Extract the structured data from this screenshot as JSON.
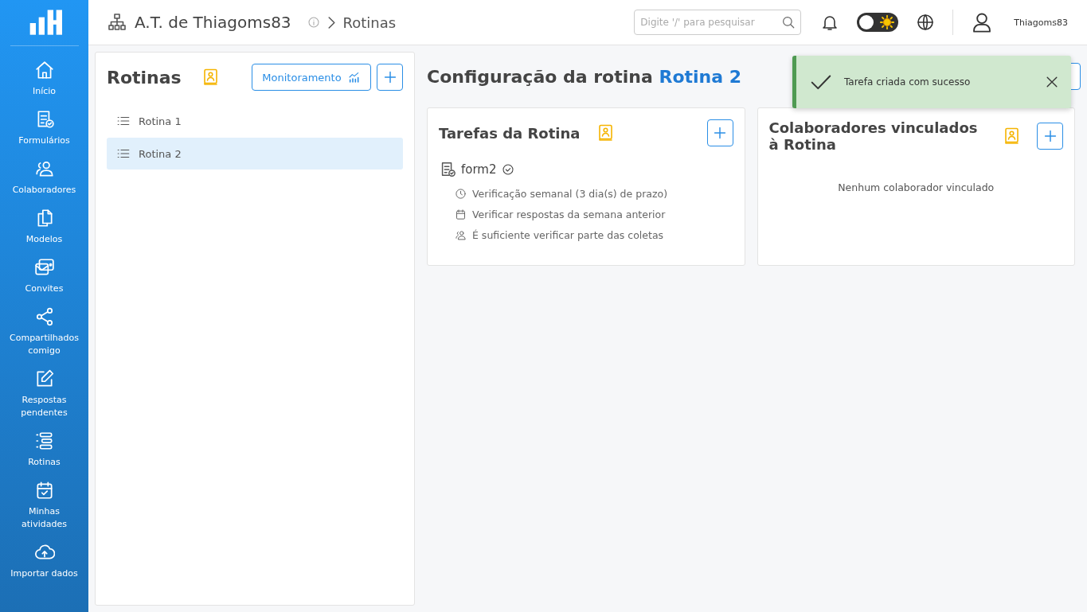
{
  "sidebar": {
    "items": [
      {
        "kind": "home",
        "label": "Início",
        "selected": false
      },
      {
        "kind": "form",
        "label": "Formulários",
        "selected": false
      },
      {
        "kind": "people",
        "label": "Colaboradores",
        "selected": false
      },
      {
        "kind": "copy",
        "label": "Modelos",
        "selected": false
      },
      {
        "kind": "mail",
        "label": "Convites",
        "selected": false
      },
      {
        "kind": "share",
        "label": "Compartilhados comigo",
        "selected": false
      },
      {
        "kind": "edit",
        "label": "Respostas pendentes",
        "selected": false
      },
      {
        "kind": "list",
        "label": "Rotinas",
        "selected": false
      },
      {
        "kind": "calendar",
        "label": "Minhas atividades",
        "selected": false
      },
      {
        "kind": "cloud",
        "label": "Importar dados",
        "selected": false
      }
    ]
  },
  "header": {
    "breadcrumb": [
      "A.T. de Thiagoms83",
      "Rotinas"
    ],
    "search": {
      "placeholder": "Digite '/' para pesquisar"
    },
    "dark_mode": false,
    "user": "Thiagoms83"
  },
  "routines_panel": {
    "title": "Rotinas",
    "monitor_button": "Monitoramento",
    "items": [
      {
        "label": "Rotina 1",
        "selected": false
      },
      {
        "label": "Rotina 2",
        "selected": true
      }
    ]
  },
  "config": {
    "title": "Configuração da rotina",
    "routine_name": "Rotina 2",
    "tasks_card": {
      "title": "Tarefas da Rotina",
      "tasks": [
        {
          "name": "form2",
          "verified": true,
          "details": [
            {
              "kind": "clock",
              "text": "Verificação semanal (3 dia(s) de prazo)"
            },
            {
              "kind": "calendar",
              "text": "Verificar respostas da semana anterior"
            },
            {
              "kind": "people",
              "text": "É suficiente verificar parte das coletas"
            }
          ]
        }
      ]
    },
    "collaborators_card": {
      "title": "Colaboradores vinculados à Rotina",
      "empty_text": "Nenhum colaborador vinculado"
    }
  },
  "toast": {
    "message": "Tarefa criada com sucesso"
  }
}
